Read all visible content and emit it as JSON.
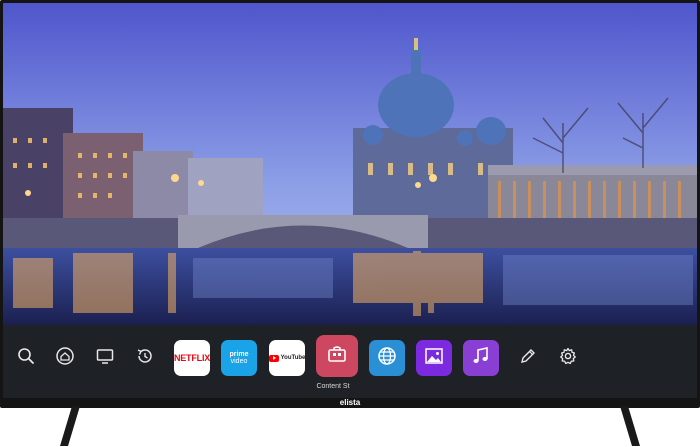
{
  "device": {
    "brand_label": "elista"
  },
  "dock": {
    "focused_label": "Content St",
    "tools": [
      {
        "id": "search",
        "icon": "search-icon"
      },
      {
        "id": "home",
        "icon": "home-icon"
      },
      {
        "id": "tv",
        "icon": "tv-icon"
      },
      {
        "id": "recent",
        "icon": "history-icon"
      }
    ],
    "apps": [
      {
        "id": "netflix",
        "label": "NETFLIX"
      },
      {
        "id": "prime",
        "label_line1": "prime",
        "label_line2": "video"
      },
      {
        "id": "youtube",
        "label": "YouTube"
      },
      {
        "id": "content-store",
        "icon": "store-icon"
      },
      {
        "id": "browser",
        "icon": "globe-icon"
      },
      {
        "id": "gallery",
        "icon": "gallery-icon"
      },
      {
        "id": "music",
        "icon": "music-icon"
      }
    ],
    "end_tools": [
      {
        "id": "edit",
        "icon": "pencil-icon"
      },
      {
        "id": "settings",
        "icon": "gear-icon"
      }
    ]
  },
  "colors": {
    "dock_bg": "#1e2126",
    "netflix_red": "#e50914",
    "prime_blue": "#1aa3e6",
    "store_pink": "#cd4760",
    "browser_blue": "#2a8fd4",
    "gallery_purple": "#7b2ae0",
    "music_purple": "#8a3fd4"
  }
}
